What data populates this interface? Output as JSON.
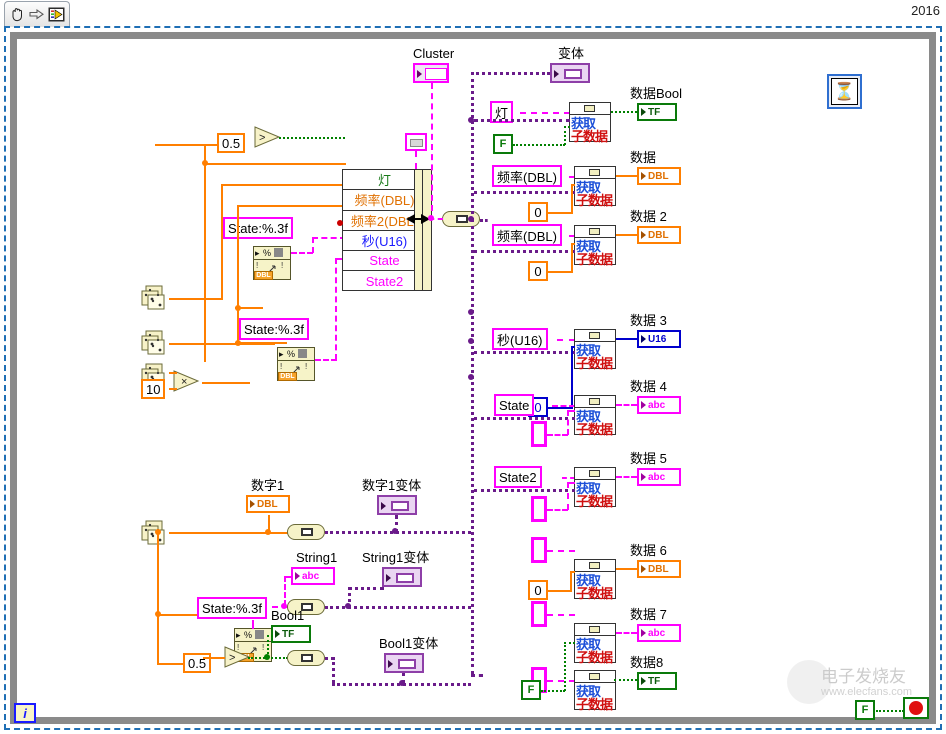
{
  "window": {
    "year_tag": "2016",
    "toolbar": {
      "hand_tool": "hand-tool",
      "arrow_tool": "run-arrow",
      "vi_icon": "vi-icon"
    }
  },
  "labels": {
    "cluster": "Cluster",
    "variant": "变体",
    "data_bool": "数据Bool",
    "data": "数据",
    "data2": "数据 2",
    "data3": "数据 3",
    "data4": "数据 4",
    "data5": "数据 5",
    "data6": "数据 6",
    "data7": "数据 7",
    "data8": "数据8",
    "num1": "数字1",
    "num1_variant": "数字1变体",
    "string1": "String1",
    "string1_variant": "String1变体",
    "bool1": "Bool1",
    "bool1_variant": "Bool1变体"
  },
  "bundle": {
    "fields": [
      {
        "name": "灯",
        "color": "#1a7a1a"
      },
      {
        "name": "频率(DBL)",
        "color": "#e07000"
      },
      {
        "name": "频率2(DBL)",
        "color": "#e07000"
      },
      {
        "name": "秒(U16)",
        "color": "#1a1aff"
      },
      {
        "name": "State",
        "color": "#ff00ff"
      },
      {
        "name": "State2",
        "color": "#ff00ff"
      }
    ]
  },
  "string_constants": {
    "lamp": "灯",
    "freq": "频率(DBL)",
    "freq2": "频率(DBL)",
    "sec": "秒(U16)",
    "state": "State",
    "state2": "State2",
    "fmt1": "State:%.3f",
    "fmt2": "State:%.3f",
    "fmt3": "State:%.3f",
    "empty": ""
  },
  "numeric_constants": {
    "half_top": "0.5",
    "ten": "10",
    "zero_a": "0",
    "zero_b": "0",
    "zero_c": "0",
    "zero_d": "0",
    "half_bottom": "0.5"
  },
  "boolean_constants": {
    "false_a": "F",
    "false_b": "F",
    "false_stop": "F"
  },
  "terminals": {
    "tf": "TF",
    "dbl": "DBL",
    "u16": "U16",
    "abc": "abc"
  },
  "nodes": {
    "get_subdata_line1": "获取",
    "get_subdata_line2": "子数据",
    "iteration": "i",
    "wait_icon": "wait-timer-icon",
    "stop_icon": "stop-button-icon",
    "random_icon": "random-number-icon",
    "greater_icon": "greater-than-icon",
    "multiply_icon": "multiply-icon",
    "format_icon": "format-into-string-icon",
    "to_variant_icon": "to-variant-icon"
  },
  "watermark": {
    "text": "电子发烧友",
    "url": "www.elecfans.com"
  },
  "colors": {
    "orange": "#ff7f00",
    "magenta": "#ff00ff",
    "green": "#008000",
    "blue": "#0000cc",
    "purple": "#6a1b8a",
    "loop_blue": "#1f6fb5",
    "loop_gray": "#8a8a8a"
  }
}
